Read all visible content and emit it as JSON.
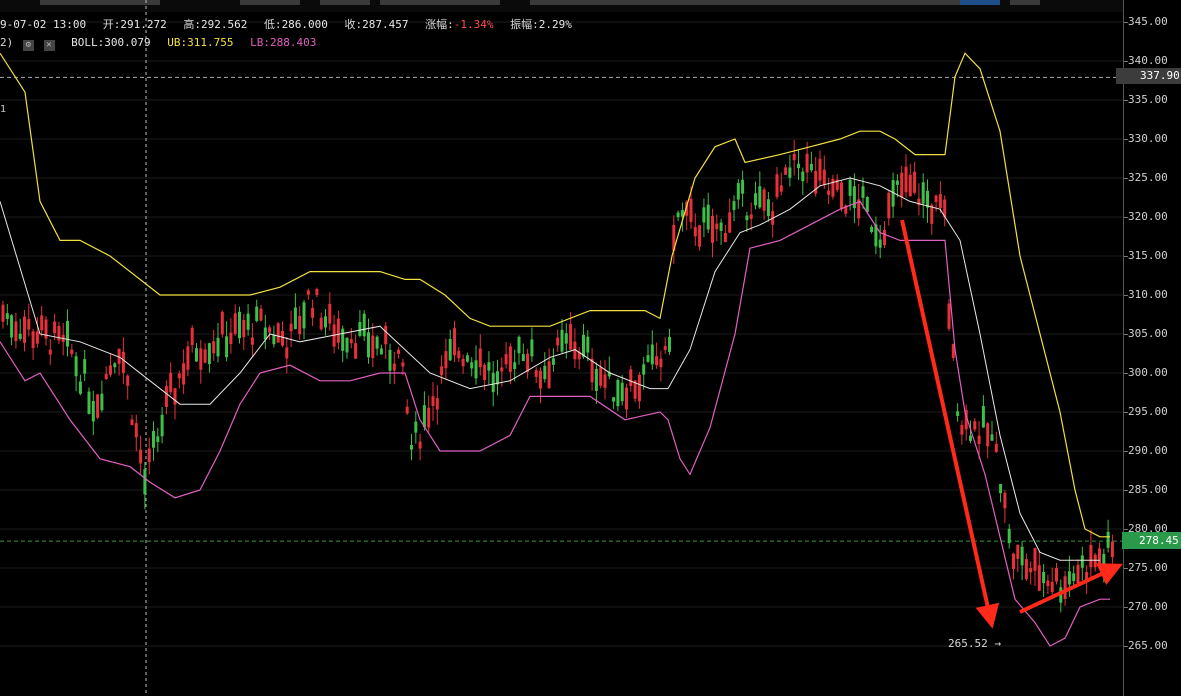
{
  "info": {
    "date": "9-07-02 13:00",
    "open_label": "开:",
    "open": "291.272",
    "high_label": "高:",
    "high": "292.562",
    "low_label": "低:",
    "low": "286.000",
    "close_label": "收:",
    "close": "287.457",
    "change_label": "涨幅:",
    "change": "-1.34%",
    "amplitude_label": "振幅:",
    "amplitude": "2.29%"
  },
  "indicator": {
    "params": "2)",
    "boll_label": "BOLL:",
    "boll": "300.079",
    "ub_label": "UB:",
    "ub": "311.755",
    "lb_label": "LB:",
    "lb": "288.403",
    "left_mark": "1"
  },
  "axis": {
    "hover_price": "337.90",
    "last_price": "278.45",
    "min_annotation": "265.52 →"
  },
  "colors": {
    "up": "#3cc04a",
    "down": "#e8303a",
    "mid": "#e8e8e8",
    "ub": "#f0e040",
    "lb": "#e060c0",
    "arrow": "#ff2a1a",
    "last": "#2a9a4a"
  },
  "chart_data": {
    "type": "candlestick",
    "ylim": [
      262,
      346
    ],
    "ticks": [
      345,
      340,
      335,
      330,
      325,
      320,
      315,
      310,
      305,
      300,
      295,
      290,
      285,
      280,
      275,
      270,
      265
    ],
    "hover_value": 337.9,
    "last_value": 278.45,
    "min_value": 265.52,
    "boll_mid_path": [
      [
        0,
        322
      ],
      [
        40,
        305
      ],
      [
        80,
        304
      ],
      [
        120,
        302
      ],
      [
        150,
        299
      ],
      [
        180,
        296
      ],
      [
        210,
        296
      ],
      [
        240,
        300
      ],
      [
        270,
        305
      ],
      [
        300,
        304
      ],
      [
        340,
        305
      ],
      [
        380,
        306
      ],
      [
        405,
        303
      ],
      [
        430,
        300
      ],
      [
        470,
        298
      ],
      [
        510,
        299
      ],
      [
        550,
        302
      ],
      [
        575,
        303
      ],
      [
        610,
        300
      ],
      [
        650,
        298
      ],
      [
        668,
        298
      ],
      [
        690,
        303
      ],
      [
        715,
        313
      ],
      [
        740,
        318
      ],
      [
        760,
        319
      ],
      [
        790,
        321
      ],
      [
        820,
        324
      ],
      [
        850,
        325
      ],
      [
        880,
        324
      ],
      [
        910,
        322
      ],
      [
        940,
        321
      ],
      [
        960,
        317
      ],
      [
        980,
        305
      ],
      [
        1000,
        292
      ],
      [
        1020,
        282
      ],
      [
        1040,
        277
      ],
      [
        1060,
        276
      ],
      [
        1080,
        276
      ],
      [
        1100,
        276
      ]
    ],
    "boll_ub_path": [
      [
        0,
        341
      ],
      [
        25,
        336
      ],
      [
        40,
        322
      ],
      [
        60,
        317
      ],
      [
        80,
        317
      ],
      [
        110,
        315
      ],
      [
        140,
        312
      ],
      [
        160,
        310
      ],
      [
        190,
        310
      ],
      [
        220,
        310
      ],
      [
        250,
        310
      ],
      [
        280,
        311
      ],
      [
        310,
        313
      ],
      [
        340,
        313
      ],
      [
        380,
        313
      ],
      [
        405,
        312
      ],
      [
        420,
        312
      ],
      [
        445,
        310
      ],
      [
        470,
        307
      ],
      [
        490,
        306
      ],
      [
        510,
        306
      ],
      [
        550,
        306
      ],
      [
        590,
        308
      ],
      [
        620,
        308
      ],
      [
        645,
        308
      ],
      [
        660,
        307
      ],
      [
        672,
        315
      ],
      [
        695,
        325
      ],
      [
        715,
        329
      ],
      [
        735,
        330
      ],
      [
        745,
        327
      ],
      [
        780,
        328
      ],
      [
        810,
        329
      ],
      [
        840,
        330
      ],
      [
        860,
        331
      ],
      [
        880,
        331
      ],
      [
        895,
        330
      ],
      [
        915,
        328
      ],
      [
        945,
        328
      ],
      [
        955,
        338
      ],
      [
        965,
        341
      ],
      [
        980,
        339
      ],
      [
        1000,
        331
      ],
      [
        1020,
        315
      ],
      [
        1040,
        305
      ],
      [
        1060,
        295
      ],
      [
        1075,
        285
      ],
      [
        1085,
        280
      ],
      [
        1100,
        279
      ],
      [
        1110,
        279
      ]
    ],
    "boll_lb_path": [
      [
        0,
        304
      ],
      [
        25,
        299
      ],
      [
        40,
        300
      ],
      [
        70,
        294
      ],
      [
        100,
        289
      ],
      [
        130,
        288
      ],
      [
        150,
        286
      ],
      [
        175,
        284
      ],
      [
        200,
        285
      ],
      [
        220,
        290
      ],
      [
        240,
        296
      ],
      [
        260,
        300
      ],
      [
        290,
        301
      ],
      [
        320,
        299
      ],
      [
        350,
        299
      ],
      [
        380,
        300
      ],
      [
        405,
        300
      ],
      [
        420,
        294
      ],
      [
        440,
        290
      ],
      [
        480,
        290
      ],
      [
        510,
        292
      ],
      [
        530,
        297
      ],
      [
        560,
        297
      ],
      [
        590,
        297
      ],
      [
        625,
        294
      ],
      [
        660,
        295
      ],
      [
        668,
        294
      ],
      [
        680,
        289
      ],
      [
        690,
        287
      ],
      [
        710,
        293
      ],
      [
        735,
        305
      ],
      [
        750,
        316
      ],
      [
        780,
        317
      ],
      [
        810,
        319
      ],
      [
        840,
        321
      ],
      [
        860,
        322
      ],
      [
        880,
        318
      ],
      [
        900,
        317
      ],
      [
        945,
        317
      ],
      [
        955,
        303
      ],
      [
        965,
        295
      ],
      [
        985,
        287
      ],
      [
        1000,
        279
      ],
      [
        1015,
        271
      ],
      [
        1035,
        268
      ],
      [
        1050,
        265
      ],
      [
        1065,
        266
      ],
      [
        1080,
        270
      ],
      [
        1100,
        271
      ],
      [
        1110,
        271
      ]
    ]
  }
}
